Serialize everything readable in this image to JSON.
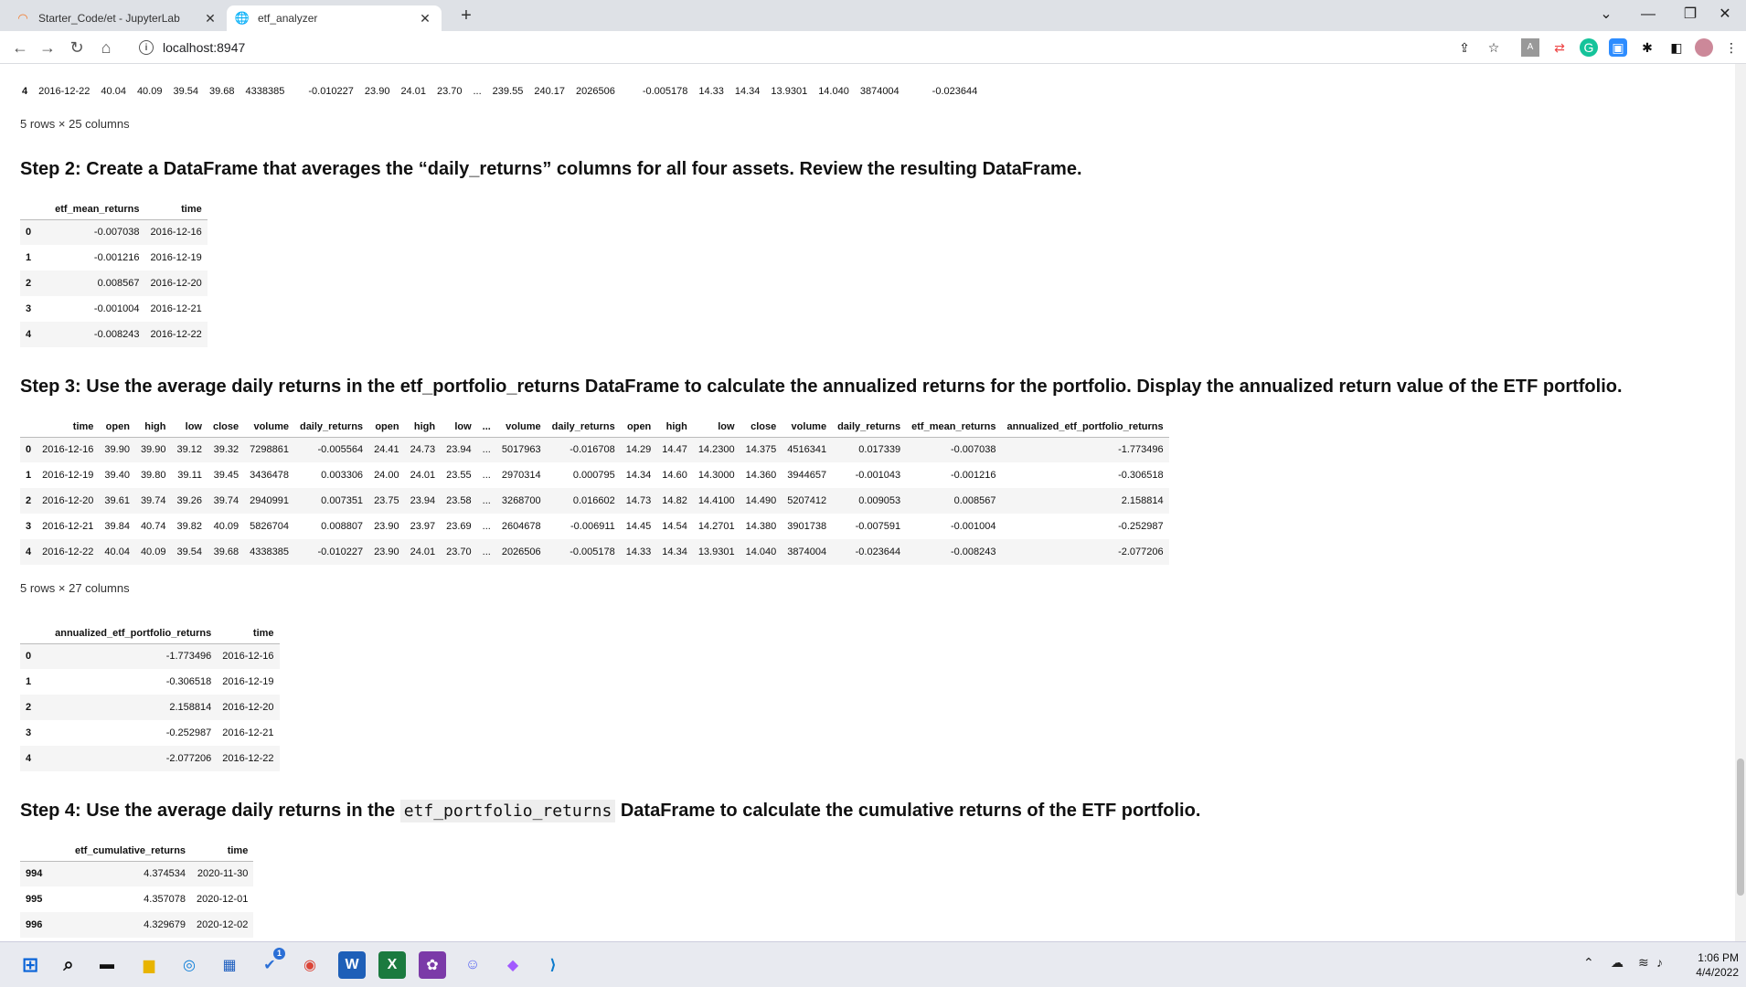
{
  "browser": {
    "tabs": [
      {
        "label": "Starter_Code/et - JupyterLab",
        "close": "✕"
      },
      {
        "label": "etf_analyzer",
        "close": "✕"
      }
    ],
    "new_tab": "+",
    "url": "localhost:8947"
  },
  "top_partial_row": {
    "idx": "4",
    "time": "2016-12-22",
    "v1": "40.04",
    "v2": "40.09",
    "v3": "39.54",
    "v4": "39.68",
    "v5": "4338385",
    "v6": "-0.010227",
    "v7": "23.90",
    "v8": "24.01",
    "v9": "23.70",
    "ell": "...",
    "v10": "239.55",
    "v11": "240.17",
    "v12": "2026506",
    "v13": "-0.005178",
    "v14": "14.33",
    "v15": "14.34",
    "v16": "13.9301",
    "v17": "14.040",
    "v18": "3874004",
    "v19": "-0.023644"
  },
  "shape1": "5 rows × 25 columns",
  "step2": {
    "heading": "Step 2: Create a DataFrame that averages the “daily_returns” columns for all four assets. Review the resulting DataFrame.",
    "columns": [
      "etf_mean_returns",
      "time"
    ],
    "rows": [
      [
        "0",
        "-0.007038",
        "2016-12-16"
      ],
      [
        "1",
        "-0.001216",
        "2016-12-19"
      ],
      [
        "2",
        "0.008567",
        "2016-12-20"
      ],
      [
        "3",
        "-0.001004",
        "2016-12-21"
      ],
      [
        "4",
        "-0.008243",
        "2016-12-22"
      ]
    ]
  },
  "step3": {
    "heading": "Step 3: Use the average daily returns in the etf_portfolio_returns DataFrame to calculate the annualized returns for the portfolio. Display the annualized return value of the ETF portfolio.",
    "columns": [
      "",
      "time",
      "open",
      "high",
      "low",
      "close",
      "volume",
      "daily_returns",
      "open",
      "high",
      "low",
      "...",
      "volume",
      "daily_returns",
      "open",
      "high",
      "low",
      "close",
      "volume",
      "daily_returns",
      "etf_mean_returns",
      "annualized_etf_portfolio_returns"
    ],
    "rows": [
      [
        "0",
        "2016-12-16",
        "39.90",
        "39.90",
        "39.12",
        "39.32",
        "7298861",
        "-0.005564",
        "24.41",
        "24.73",
        "23.94",
        "...",
        "5017963",
        "-0.016708",
        "14.29",
        "14.47",
        "14.2300",
        "14.375",
        "4516341",
        "0.017339",
        "-0.007038",
        "-1.773496"
      ],
      [
        "1",
        "2016-12-19",
        "39.40",
        "39.80",
        "39.11",
        "39.45",
        "3436478",
        "0.003306",
        "24.00",
        "24.01",
        "23.55",
        "...",
        "2970314",
        "0.000795",
        "14.34",
        "14.60",
        "14.3000",
        "14.360",
        "3944657",
        "-0.001043",
        "-0.001216",
        "-0.306518"
      ],
      [
        "2",
        "2016-12-20",
        "39.61",
        "39.74",
        "39.26",
        "39.74",
        "2940991",
        "0.007351",
        "23.75",
        "23.94",
        "23.58",
        "...",
        "3268700",
        "0.016602",
        "14.73",
        "14.82",
        "14.4100",
        "14.490",
        "5207412",
        "0.009053",
        "0.008567",
        "2.158814"
      ],
      [
        "3",
        "2016-12-21",
        "39.84",
        "40.74",
        "39.82",
        "40.09",
        "5826704",
        "0.008807",
        "23.90",
        "23.97",
        "23.69",
        "...",
        "2604678",
        "-0.006911",
        "14.45",
        "14.54",
        "14.2701",
        "14.380",
        "3901738",
        "-0.007591",
        "-0.001004",
        "-0.252987"
      ],
      [
        "4",
        "2016-12-22",
        "40.04",
        "40.09",
        "39.54",
        "39.68",
        "4338385",
        "-0.010227",
        "23.90",
        "24.01",
        "23.70",
        "...",
        "2026506",
        "-0.005178",
        "14.33",
        "14.34",
        "13.9301",
        "14.040",
        "3874004",
        "-0.023644",
        "-0.008243",
        "-2.077206"
      ]
    ],
    "shape": "5 rows × 27 columns",
    "annual_columns": [
      "annualized_etf_portfolio_returns",
      "time"
    ],
    "annual_rows": [
      [
        "0",
        "-1.773496",
        "2016-12-16"
      ],
      [
        "1",
        "-0.306518",
        "2016-12-19"
      ],
      [
        "2",
        "2.158814",
        "2016-12-20"
      ],
      [
        "3",
        "-0.252987",
        "2016-12-21"
      ],
      [
        "4",
        "-2.077206",
        "2016-12-22"
      ]
    ]
  },
  "step4": {
    "heading_pre": "Step 4: Use the average daily returns in the ",
    "heading_code": "etf_portfolio_returns",
    "heading_post": " DataFrame to calculate the cumulative returns of the ETF portfolio.",
    "columns": [
      "etf_cumulative_returns",
      "time"
    ],
    "rows": [
      [
        "994",
        "4.374534",
        "2020-11-30"
      ],
      [
        "995",
        "4.357078",
        "2020-12-01"
      ],
      [
        "996",
        "4.329679",
        "2020-12-02"
      ]
    ]
  },
  "taskbar": {
    "time": "1:06 PM",
    "date": "4/4/2022",
    "badge": "1"
  }
}
